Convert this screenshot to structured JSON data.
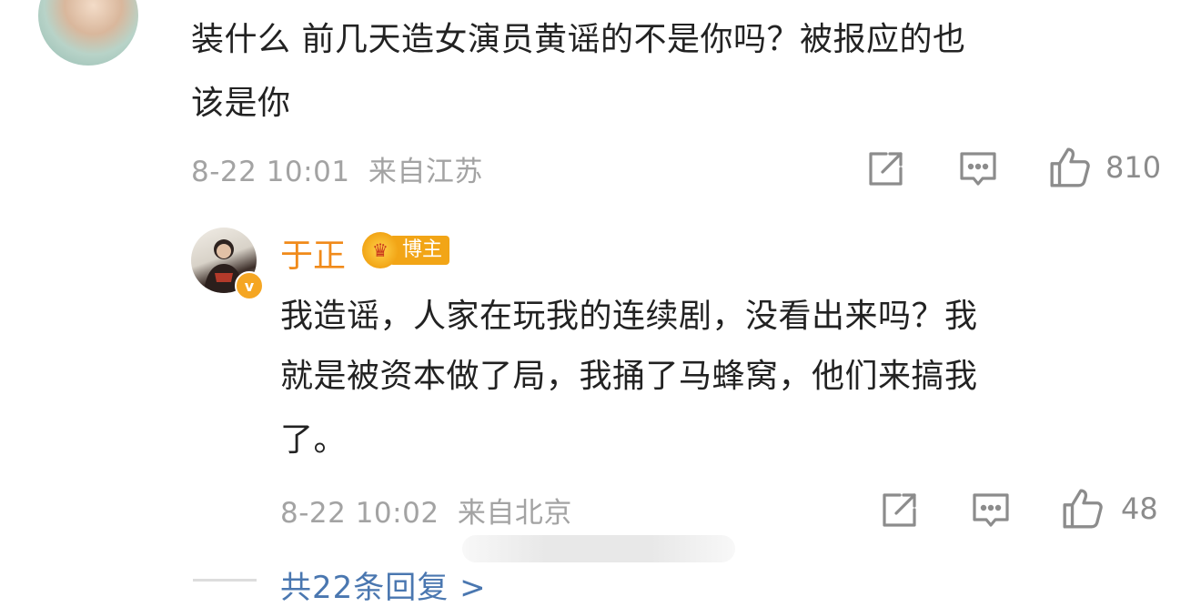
{
  "comment": {
    "text_line1": "装什么 前几天造女演员黄谣的不是你吗？被报应的也",
    "text_line2": "该是你",
    "timestamp": "8-22 10:01",
    "location": "来自江苏",
    "likes": "810"
  },
  "reply": {
    "username": "于正",
    "badge_label": "博主",
    "badge_icon": "crown-icon",
    "verified_icon": "verified-v-icon",
    "text_line1": "我造谣，人家在玩我的连续剧，没看出来吗？我",
    "text_line2": "就是被资本做了局，我捅了马蜂窝，他们来搞我",
    "text_line3": "了。",
    "timestamp": "8-22 10:02",
    "location": "来自北京",
    "likes": "48"
  },
  "more_replies": "共22条回复 >",
  "icons": {
    "share": "share-icon",
    "comment": "comment-icon",
    "like": "thumbs-up-icon"
  },
  "colors": {
    "username": "#f08a1a",
    "link": "#4a77b0",
    "meta": "#a3a3a3"
  }
}
